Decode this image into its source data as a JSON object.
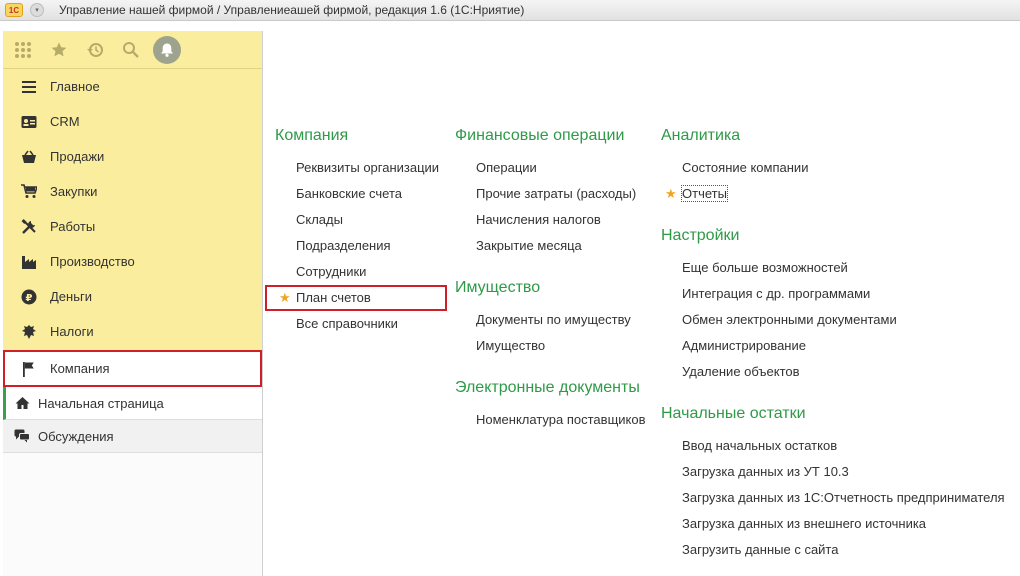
{
  "window": {
    "logo_text": "1С",
    "title": "Управление нашей фирмой / Управлениеашей фирмой, редакция 1.6  (1С:Нриятие)"
  },
  "toolbar": {
    "icons": [
      "apps-grid-icon",
      "star-icon",
      "history-icon",
      "search-icon",
      "bell-icon"
    ]
  },
  "sections": [
    {
      "label": "Главное",
      "icon": "menu-lines-icon"
    },
    {
      "label": "CRM",
      "icon": "contact-card-icon"
    },
    {
      "label": "Продажи",
      "icon": "basket-icon"
    },
    {
      "label": "Закупки",
      "icon": "cart-icon"
    },
    {
      "label": "Работы",
      "icon": "tools-icon"
    },
    {
      "label": "Производство",
      "icon": "factory-icon"
    },
    {
      "label": "Деньги",
      "icon": "ruble-coin-icon"
    },
    {
      "label": "Налоги",
      "icon": "emblem-icon"
    },
    {
      "label": "Компания",
      "icon": "flag-icon",
      "active": true
    }
  ],
  "nav": [
    {
      "label": "Начальная страница",
      "icon": "home-icon"
    },
    {
      "label": "Обсуждения",
      "icon": "chat-icon"
    }
  ],
  "columns": [
    {
      "groups": [
        {
          "title": "Компания",
          "items": [
            "Реквизиты организации",
            "Банковские счета",
            "Склады",
            "Подразделения",
            "Сотрудники",
            "План счетов",
            "Все справочники"
          ]
        }
      ]
    },
    {
      "groups": [
        {
          "title": "Финансовые операции",
          "items": [
            "Операции",
            "Прочие затраты (расходы)",
            "Начисления налогов",
            "Закрытие месяца"
          ]
        },
        {
          "title": "Имущество",
          "items": [
            "Документы по имуществу",
            "Имущество"
          ]
        },
        {
          "title": "Электронные документы",
          "items": [
            "Номенклатура поставщиков"
          ]
        }
      ]
    },
    {
      "groups": [
        {
          "title": "Аналитика",
          "items": [
            "Состояние компании",
            "Отчеты"
          ]
        },
        {
          "title": "Настройки",
          "items": [
            "Еще больше возможностей",
            "Интеграция с др. программами",
            "Обмен электронными документами",
            "Администрирование",
            "Удаление объектов"
          ]
        },
        {
          "title": "Начальные остатки",
          "items": [
            "Ввод начальных остатков",
            "Загрузка данных из УТ 10.3",
            "Загрузка данных из 1С:Отчетность предпринимателя",
            "Загрузка данных из внешнего источника",
            "Загрузить данные с сайта"
          ]
        }
      ]
    }
  ],
  "colors": {
    "accent_green": "#2f9a48",
    "panel_yellow": "#fbed9e",
    "highlight_red": "#d11f2a",
    "star": "#f0a522"
  }
}
